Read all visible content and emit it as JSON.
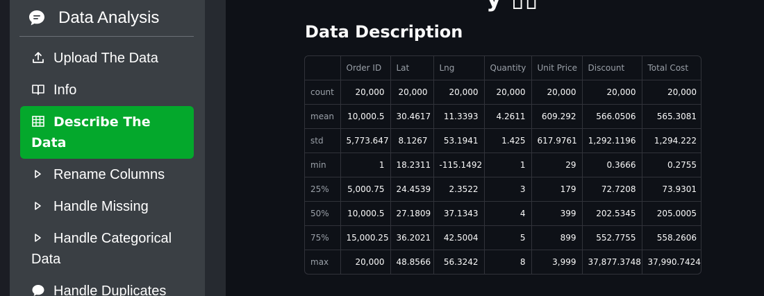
{
  "sidebar": {
    "title": "Data Analysis",
    "items": [
      {
        "label": "Upload The Data",
        "icon": "upload-icon"
      },
      {
        "label": "Info",
        "icon": "book-icon"
      },
      {
        "label": "Describe The Data",
        "icon": "table-icon",
        "active": true
      },
      {
        "label": "Rename Columns",
        "icon": "caret-right-icon"
      },
      {
        "label": "Handle Missing",
        "icon": "caret-right-icon"
      },
      {
        "label": "Handle Categorical Data",
        "icon": "caret-right-icon"
      },
      {
        "label": "Handle Duplicates",
        "icon": "chat-icon"
      }
    ],
    "active_color": "#04a82c"
  },
  "main": {
    "section_title": "Data Description",
    "table": {
      "columns": [
        "",
        "Order ID",
        "Lat",
        "Lng",
        "Quantity",
        "Unit Price",
        "Discount",
        "Total Cost"
      ],
      "rows": [
        [
          "count",
          "20,000",
          "20,000",
          "20,000",
          "20,000",
          "20,000",
          "20,000",
          "20,000"
        ],
        [
          "mean",
          "10,000.5",
          "30.4617",
          "11.3393",
          "4.2611",
          "609.292",
          "566.0506",
          "565.3081"
        ],
        [
          "std",
          "5,773.647",
          "8.1267",
          "53.1941",
          "1.425",
          "617.9761",
          "1,292.1196",
          "1,294.222"
        ],
        [
          "min",
          "1",
          "18.2311",
          "-115.1492",
          "1",
          "29",
          "0.3666",
          "0.2755"
        ],
        [
          "25%",
          "5,000.75",
          "24.4539",
          "2.3522",
          "3",
          "179",
          "72.7208",
          "73.9301"
        ],
        [
          "50%",
          "10,000.5",
          "27.1809",
          "37.1343",
          "4",
          "399",
          "202.5345",
          "205.0005"
        ],
        [
          "75%",
          "15,000.25",
          "36.2021",
          "42.5004",
          "5",
          "899",
          "552.7755",
          "558.2606"
        ],
        [
          "max",
          "20,000",
          "48.8566",
          "56.3242",
          "8",
          "3,999",
          "37,877.3748",
          "37,990.7424"
        ]
      ]
    }
  }
}
